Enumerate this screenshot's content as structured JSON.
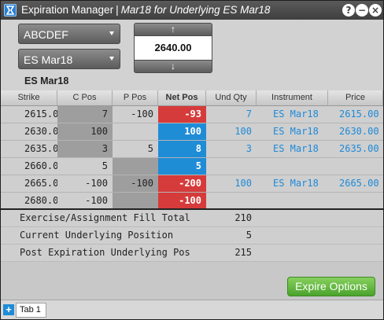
{
  "window": {
    "title_main": "Expiration Manager",
    "title_separator": "|",
    "title_detail": "Mar18 for Underlying ES Mar18",
    "help_glyph": "?",
    "minimize_glyph": "−",
    "close_glyph": "×"
  },
  "controls": {
    "symbol_value": "ABCDEF",
    "expiry_value": "ES Mar18",
    "price_value": "2640.00",
    "up_glyph": "↑",
    "down_glyph": "↓",
    "contract_label": "ES Mar18"
  },
  "table": {
    "headers": [
      "Strike",
      "C Pos",
      "P Pos",
      "Net Pos",
      "Und Qty",
      "Instrument",
      "Price"
    ],
    "rows": [
      {
        "strike": "2615.00",
        "cpos": "7",
        "ppos": "-100",
        "net": "-93",
        "und": "7",
        "inst": "ES Mar18",
        "price": "2615.00"
      },
      {
        "strike": "2630.00",
        "cpos": "100",
        "ppos": "",
        "net": "100",
        "und": "100",
        "inst": "ES Mar18",
        "price": "2630.00"
      },
      {
        "strike": "2635.00",
        "cpos": "3",
        "ppos": "5",
        "net": "8",
        "und": "3",
        "inst": "ES Mar18",
        "price": "2635.00"
      },
      {
        "strike": "2660.00",
        "cpos": "5",
        "ppos": "",
        "net": "5",
        "und": "",
        "inst": "",
        "price": ""
      },
      {
        "strike": "2665.00",
        "cpos": "-100",
        "ppos": "-100",
        "net": "-200",
        "und": "100",
        "inst": "ES Mar18",
        "price": "2665.00"
      },
      {
        "strike": "2680.00",
        "cpos": "-100",
        "ppos": "",
        "net": "-100",
        "und": "",
        "inst": "",
        "price": ""
      }
    ]
  },
  "summary": [
    {
      "label": "Exercise/Assignment Fill Total",
      "value": "210"
    },
    {
      "label": "Current Underlying Position",
      "value": "5"
    },
    {
      "label": "Post Expiration Underlying Pos",
      "value": "215"
    }
  ],
  "actions": {
    "expire_label": "Expire Options"
  },
  "tabs": {
    "add_glyph": "+",
    "items": [
      {
        "label": "Tab 1"
      }
    ]
  },
  "colors": {
    "accent_blue": "#1f8cd6",
    "negative_red": "#d63b3b",
    "expire_green": "#5cb83a"
  }
}
